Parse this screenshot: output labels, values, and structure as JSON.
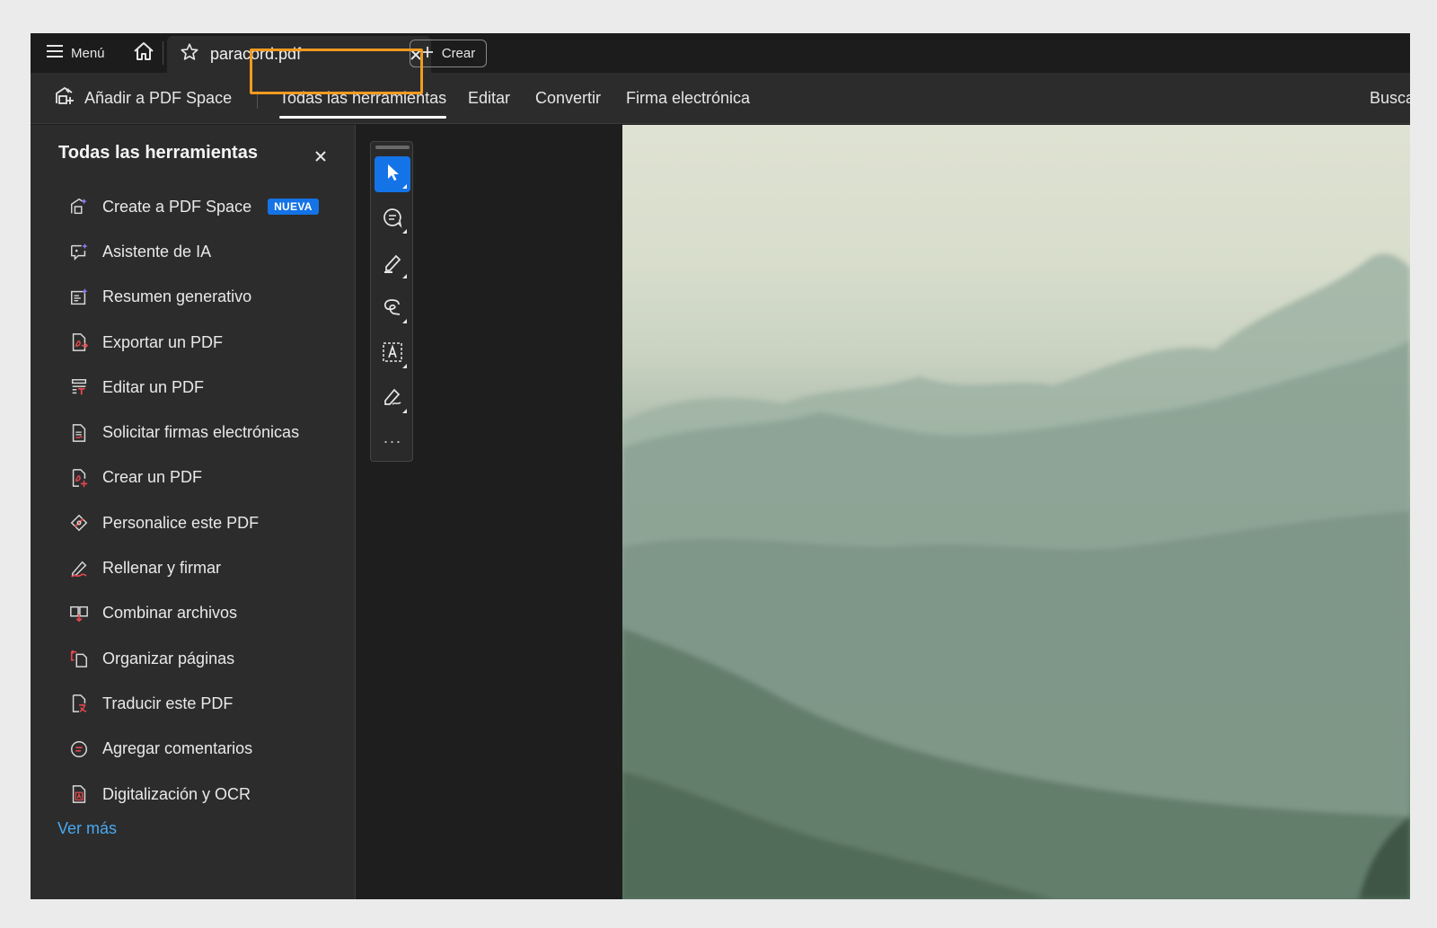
{
  "titlebar": {
    "menu_label": "Menú",
    "doc_tab_title": "paracord.pdf",
    "create_label": "Crear"
  },
  "toolbar": {
    "add_space_label": "Añadir a PDF Space",
    "tabs": [
      {
        "label": "Todas las herramientas",
        "active": true
      },
      {
        "label": "Editar",
        "active": false
      },
      {
        "label": "Convertir",
        "active": false
      },
      {
        "label": "Firma electrónica",
        "active": false
      }
    ],
    "search_label": "Busca",
    "highlight_color": "#f29a1f"
  },
  "side_panel": {
    "title": "Todas las herramientas",
    "tools": [
      {
        "label": "Create a PDF Space",
        "badge": "NUEVA",
        "icon": "pdf-space-icon"
      },
      {
        "label": "Asistente de IA",
        "icon": "ai-assistant-icon"
      },
      {
        "label": "Resumen generativo",
        "icon": "generative-summary-icon"
      },
      {
        "label": "Exportar un PDF",
        "icon": "export-pdf-icon"
      },
      {
        "label": "Editar un PDF",
        "icon": "edit-pdf-icon"
      },
      {
        "label": "Solicitar firmas electrónicas",
        "icon": "request-signatures-icon"
      },
      {
        "label": "Crear un PDF",
        "icon": "create-pdf-icon"
      },
      {
        "label": "Personalice este PDF",
        "icon": "customize-pdf-icon"
      },
      {
        "label": "Rellenar y firmar",
        "icon": "fill-sign-icon"
      },
      {
        "label": "Combinar archivos",
        "icon": "combine-files-icon"
      },
      {
        "label": "Organizar páginas",
        "icon": "organize-pages-icon"
      },
      {
        "label": "Traducir este PDF",
        "icon": "translate-pdf-icon"
      },
      {
        "label": "Agregar comentarios",
        "icon": "add-comments-icon"
      },
      {
        "label": "Digitalización y OCR",
        "icon": "scan-ocr-icon"
      }
    ],
    "see_more_label": "Ver más"
  },
  "tool_rail": {
    "tools": [
      "select-icon",
      "comment-icon",
      "highlight-pen-icon",
      "lasso-draw-icon",
      "text-select-icon",
      "sign-icon"
    ],
    "more_label": "···"
  },
  "colors": {
    "accent": "#1473e6",
    "link": "#4aa8f0",
    "icon_red": "#e34850"
  }
}
